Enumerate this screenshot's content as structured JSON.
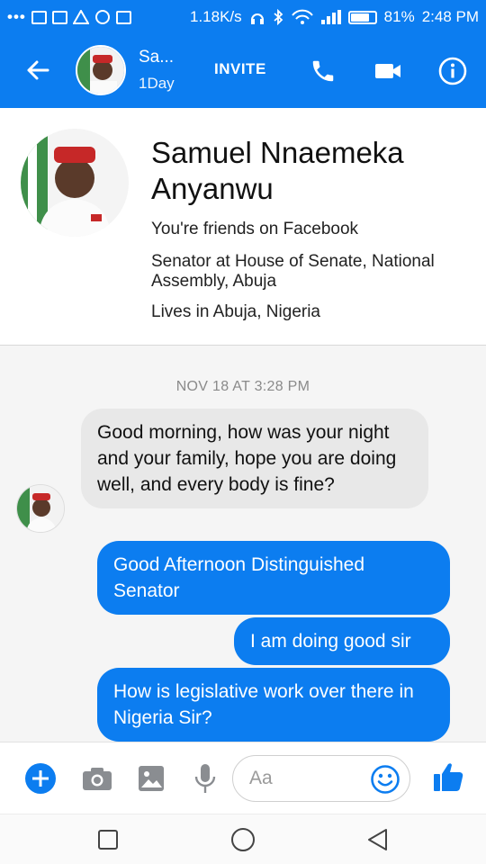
{
  "status_bar": {
    "speed": "1.18K/s",
    "battery": "81%",
    "battery_level": 0.81,
    "time": "2:48 PM"
  },
  "header": {
    "name": "Sa...",
    "status": "1Day",
    "invite_label": "INVITE"
  },
  "profile": {
    "name": "Samuel Nnaemeka Anyanwu",
    "friends": "You're friends on Facebook",
    "work": "Senator at House of Senate, National Assembly, Abuja",
    "lives": "Lives in Abuja, Nigeria"
  },
  "chat": {
    "timestamp": "NOV 18 AT 3:28 PM",
    "messages": [
      {
        "direction": "incoming",
        "text": "Good morning, how was your night and your family, hope you are doing well, and every body is fine?"
      },
      {
        "direction": "outgoing",
        "text": "Good Afternoon Distinguished Senator"
      },
      {
        "direction": "outgoing",
        "text": "I am doing good sir"
      },
      {
        "direction": "outgoing",
        "text": "How is legislative work over there in Nigeria Sir?"
      }
    ]
  },
  "composer": {
    "placeholder": "Aa"
  },
  "colors": {
    "brand": "#0c7df0",
    "incoming_bubble": "#e8e8e8"
  }
}
